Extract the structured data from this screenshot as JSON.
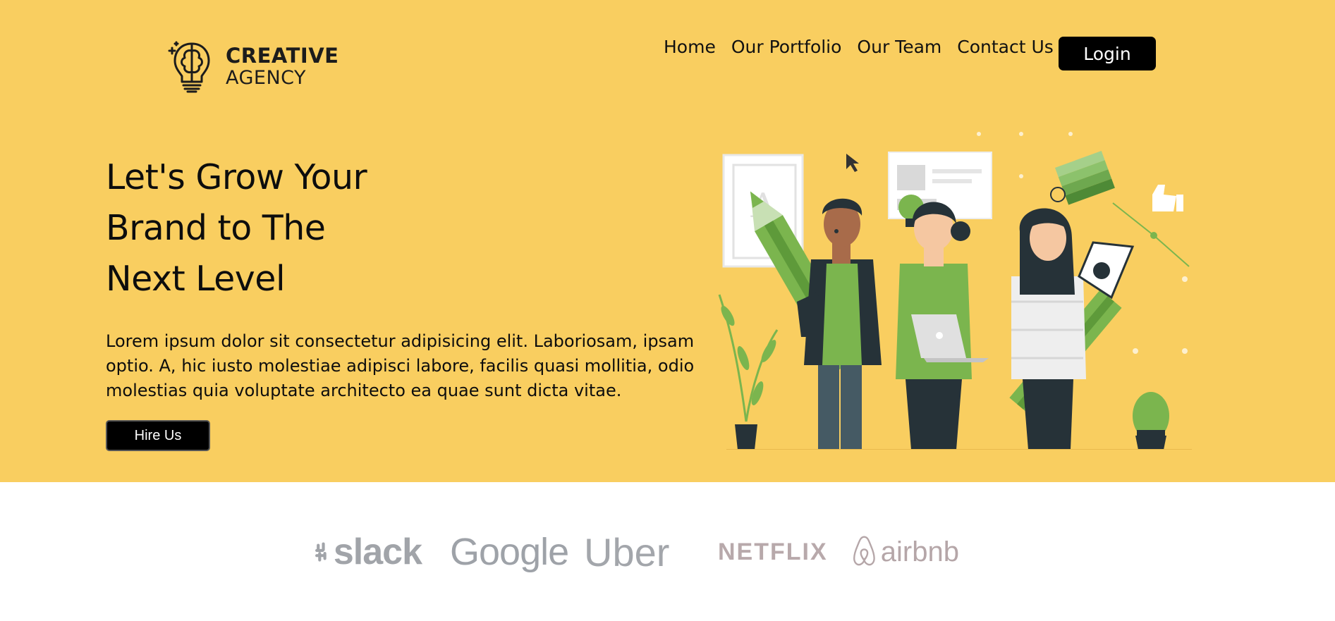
{
  "header": {
    "logo_line1": "CREATIVE",
    "logo_line2": "AGENCY",
    "logo_icon": "lightbulb-brain-icon",
    "nav": [
      "Home",
      "Our Portfolio",
      "Our Team",
      "Contact Us"
    ],
    "login_label": "Login"
  },
  "hero": {
    "headline": [
      "Let's Grow Your",
      "Brand to The",
      "Next Level"
    ],
    "lead": "Lorem ipsum dolor sit consectetur adipisicing elit. Laboriosam, ipsam optio. A, hic iusto molestiae adipisci labore, facilis quasi mollitia, odio molestias quia voluptate architecto ea quae sunt dicta vitae.",
    "hire_label": "Hire Us",
    "illustration": "team-designers-illustration"
  },
  "brands": [
    "slack",
    "Google",
    "Uber",
    "NETFLIX",
    "airbnb"
  ],
  "colors": {
    "hero_bg": "#F9CE60",
    "accent_green": "#7BB54E",
    "dark": "#000000",
    "brand_gray": "#A0A3A8"
  }
}
